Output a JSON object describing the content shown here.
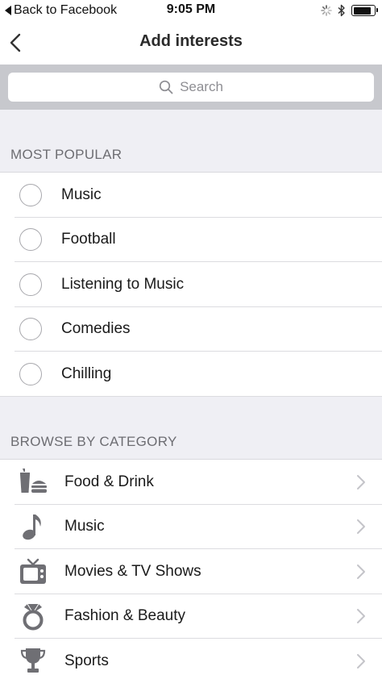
{
  "status_bar": {
    "back_label": "Back to Facebook",
    "time": "9:05 PM",
    "battery_level": 0.85
  },
  "nav": {
    "title": "Add interests"
  },
  "search": {
    "placeholder": "Search"
  },
  "most_popular": {
    "header": "MOST POPULAR",
    "items": [
      {
        "label": "Music"
      },
      {
        "label": "Football"
      },
      {
        "label": "Listening to Music"
      },
      {
        "label": "Comedies"
      },
      {
        "label": "Chilling"
      }
    ]
  },
  "browse": {
    "header": "BROWSE BY CATEGORY",
    "items": [
      {
        "label": "Food & Drink",
        "icon": "food-drink-icon"
      },
      {
        "label": "Music",
        "icon": "music-note-icon"
      },
      {
        "label": "Movies & TV Shows",
        "icon": "tv-icon"
      },
      {
        "label": "Fashion & Beauty",
        "icon": "ring-icon"
      },
      {
        "label": "Sports",
        "icon": "trophy-icon"
      }
    ]
  },
  "colors": {
    "icon_gray": "#6f6f74",
    "chevron": "#c4c4c9",
    "section_bg": "#efeff4",
    "search_bar_bg": "#c7c8cd"
  }
}
